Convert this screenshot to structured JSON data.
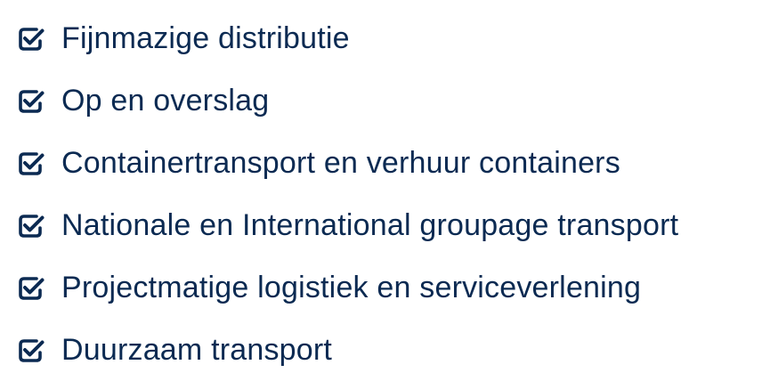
{
  "colors": {
    "text": "#0b2a52",
    "icon": "#0b2a52"
  },
  "checklist": {
    "icon": "checkbox-checked-icon",
    "items": [
      {
        "label": "Fijnmazige distributie"
      },
      {
        "label": "Op en overslag"
      },
      {
        "label": "Containertransport en verhuur containers"
      },
      {
        "label": "Nationale en International groupage transport"
      },
      {
        "label": "Projectmatige logistiek en serviceverlening"
      },
      {
        "label": "Duurzaam transport"
      }
    ]
  }
}
